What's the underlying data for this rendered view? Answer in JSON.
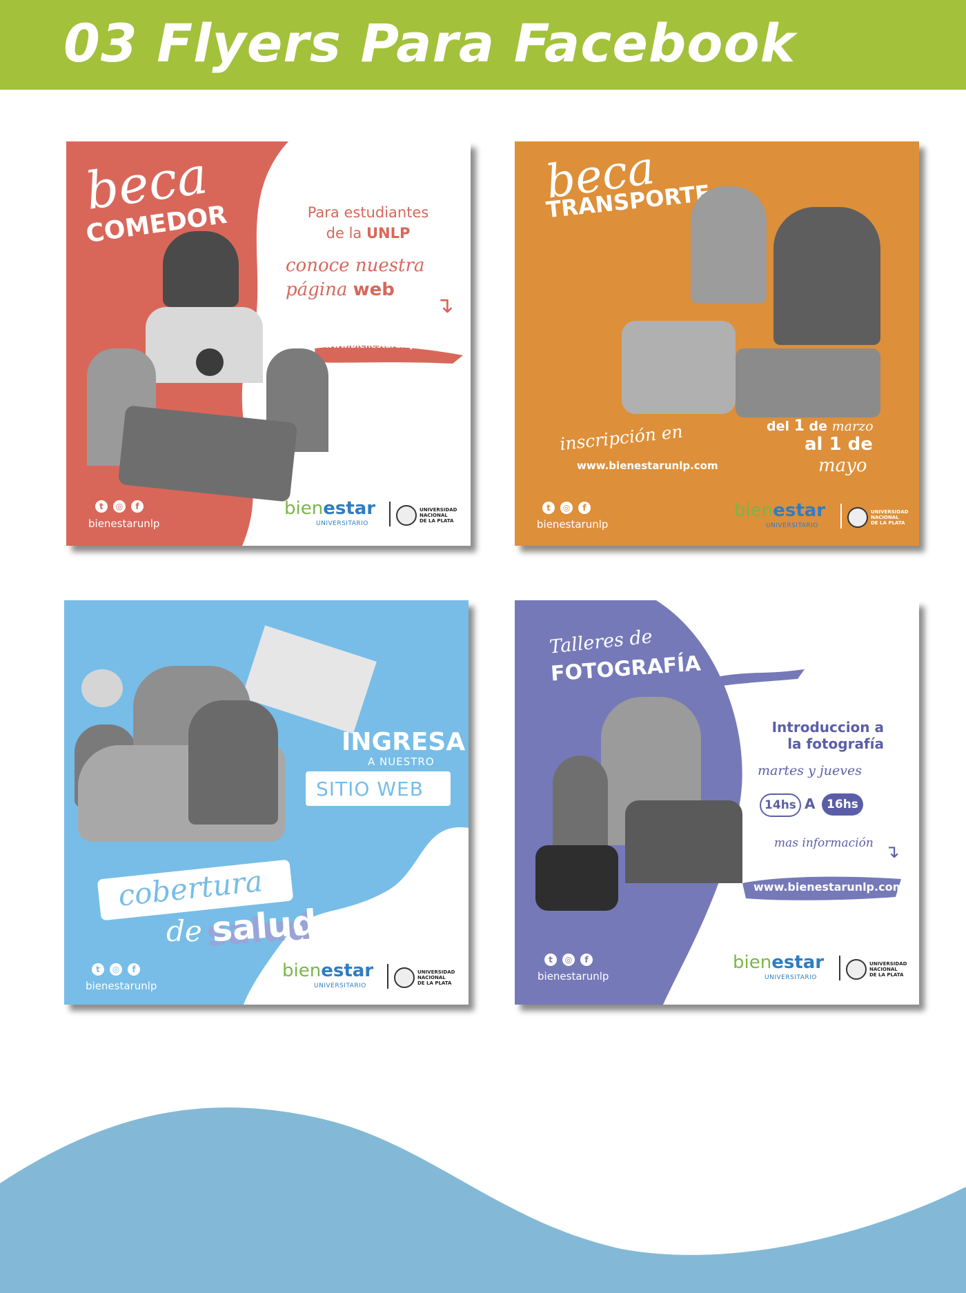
{
  "header": {
    "title": "03 Flyers Para Facebook"
  },
  "colors": {
    "header_green": "#a3c13a",
    "wave_blue": "#83b9d6"
  },
  "brand": {
    "bien": "bien",
    "estar": "estar",
    "universitario": "UNIVERSITARIO",
    "unlp_line1": "UNIVERSIDAD",
    "unlp_line2": "NACIONAL",
    "unlp_line3": "DE LA PLATA",
    "handle": "bienestarunlp"
  },
  "flyer1": {
    "title_script": "beca",
    "title_block": "COMEDOR",
    "subtitle_line1": "Para estudiantes",
    "subtitle_line2_prefix": "de la ",
    "subtitle_line2_bold": "UNLP",
    "cta_line1": "conoce nuestra",
    "cta_line2_script": "página ",
    "cta_line2_bold": "web",
    "url": "www.bienestarunlp.com"
  },
  "flyer2": {
    "title_script": "beca",
    "title_block": "TRANSPORTE",
    "inscripcion": "inscripción en",
    "url": "www.bienestarunlp.com",
    "date_del": "del ",
    "date_1a": "1",
    "date_de": " de ",
    "date_marzo": "marzo",
    "date_al": "al 1 de",
    "date_mayo": "mayo"
  },
  "flyer3": {
    "ingresa": "INGRESA",
    "a_nuestro": "A NUESTRO",
    "sitio_web": "SITIO WEB",
    "cobertura": "cobertura",
    "de": "de",
    "salud": "salud"
  },
  "flyer4": {
    "talleres": "Talleres de",
    "fotografia": "FOTOGRAFÍA",
    "intro_line1": "Introduccion a",
    "intro_line2": "la fotografía",
    "days": "martes y jueves",
    "from": "14hs",
    "a": "A",
    "to": "16hs",
    "mas_info": "mas información",
    "url": "www.bienestarunlp.com"
  }
}
